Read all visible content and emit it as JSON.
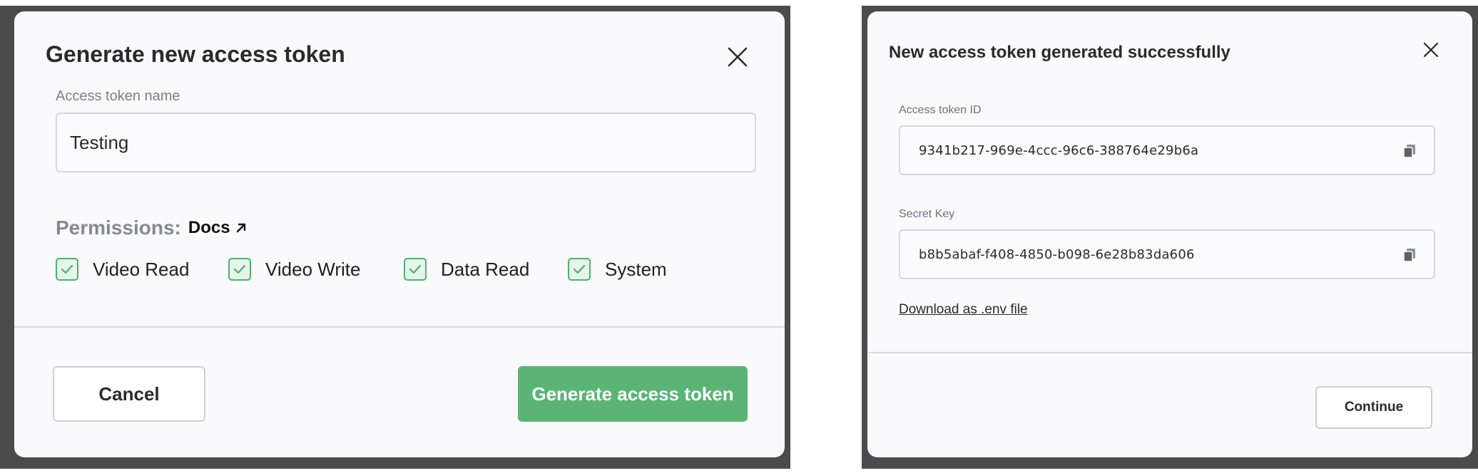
{
  "generate_modal": {
    "title": "Generate new access token",
    "close_icon": "close-icon",
    "name_label": "Access token name",
    "name_value": "Testing",
    "permissions_label": "Permissions:",
    "docs_link": "Docs",
    "permissions": [
      {
        "label": "Video Read",
        "checked": true
      },
      {
        "label": "Video Write",
        "checked": true
      },
      {
        "label": "Data Read",
        "checked": true
      },
      {
        "label": "System",
        "checked": true
      }
    ],
    "cancel_label": "Cancel",
    "generate_label": "Generate access token"
  },
  "success_modal": {
    "title": "New access token generated successfully",
    "close_icon": "close-icon",
    "token_id_label": "Access token ID",
    "token_id_value": "9341b217-969e-4ccc-96c6-388764e29b6a",
    "secret_key_label": "Secret Key",
    "secret_key_value": "b8b5abaf-f408-4850-b098-6e28b83da606",
    "download_link": "Download as .env file",
    "continue_label": "Continue"
  },
  "colors": {
    "accent_green": "#5bb476",
    "checkbox_border": "#4fb06e",
    "checkbox_fill": "#e6f5ea",
    "modal_bg": "#fafafc",
    "backdrop": "#4b4b4b"
  }
}
